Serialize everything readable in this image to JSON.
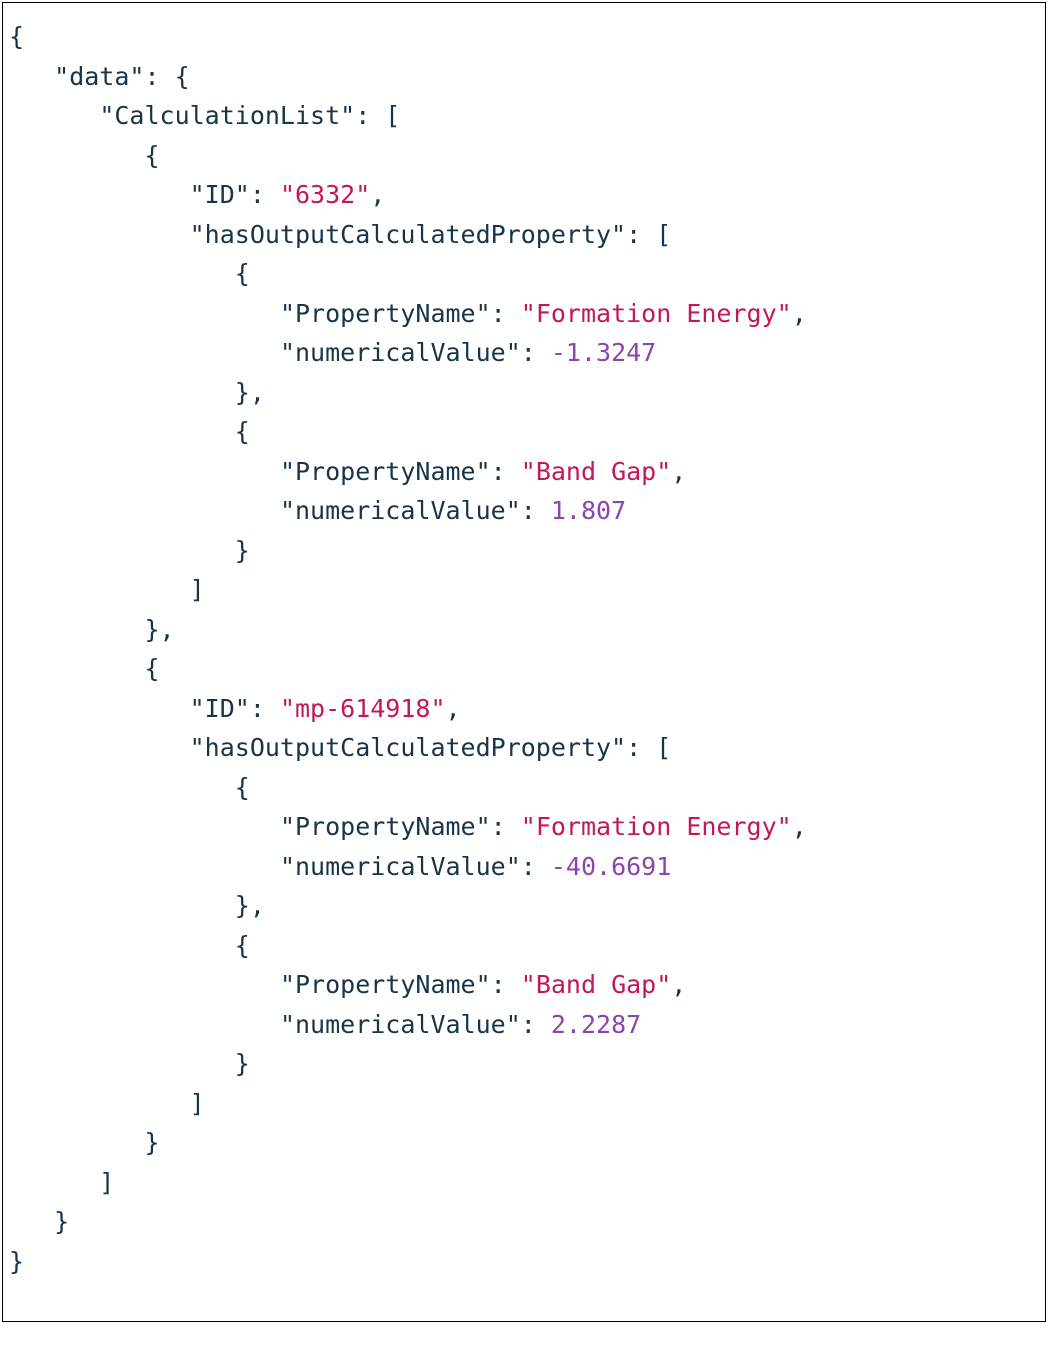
{
  "tokens": [
    {
      "t": "{",
      "c": "punct",
      "nl": true
    },
    {
      "t": "   ",
      "c": "punct"
    },
    {
      "t": "\"data\"",
      "c": "key"
    },
    {
      "t": ": {",
      "c": "punct",
      "nl": true
    },
    {
      "t": "      ",
      "c": "punct"
    },
    {
      "t": "\"CalculationList\"",
      "c": "key"
    },
    {
      "t": ": [",
      "c": "punct",
      "nl": true
    },
    {
      "t": "         {",
      "c": "punct",
      "nl": true
    },
    {
      "t": "            ",
      "c": "punct"
    },
    {
      "t": "\"ID\"",
      "c": "key"
    },
    {
      "t": ": ",
      "c": "punct"
    },
    {
      "t": "\"6332\"",
      "c": "str"
    },
    {
      "t": ",",
      "c": "punct",
      "nl": true
    },
    {
      "t": "            ",
      "c": "punct"
    },
    {
      "t": "\"hasOutputCalculatedProperty\"",
      "c": "key"
    },
    {
      "t": ": [",
      "c": "punct",
      "nl": true
    },
    {
      "t": "               {",
      "c": "punct",
      "nl": true
    },
    {
      "t": "                  ",
      "c": "punct"
    },
    {
      "t": "\"PropertyName\"",
      "c": "key"
    },
    {
      "t": ": ",
      "c": "punct"
    },
    {
      "t": "\"Formation Energy\"",
      "c": "str"
    },
    {
      "t": ",",
      "c": "punct",
      "nl": true
    },
    {
      "t": "                  ",
      "c": "punct"
    },
    {
      "t": "\"numericalValue\"",
      "c": "key"
    },
    {
      "t": ": ",
      "c": "punct"
    },
    {
      "t": "-1.3247",
      "c": "num",
      "nl": true
    },
    {
      "t": "               },",
      "c": "punct",
      "nl": true
    },
    {
      "t": "               {",
      "c": "punct",
      "nl": true
    },
    {
      "t": "                  ",
      "c": "punct"
    },
    {
      "t": "\"PropertyName\"",
      "c": "key"
    },
    {
      "t": ": ",
      "c": "punct"
    },
    {
      "t": "\"Band Gap\"",
      "c": "str"
    },
    {
      "t": ",",
      "c": "punct",
      "nl": true
    },
    {
      "t": "                  ",
      "c": "punct"
    },
    {
      "t": "\"numericalValue\"",
      "c": "key"
    },
    {
      "t": ": ",
      "c": "punct"
    },
    {
      "t": "1.807",
      "c": "num",
      "nl": true
    },
    {
      "t": "               }",
      "c": "punct",
      "nl": true
    },
    {
      "t": "            ]",
      "c": "punct",
      "nl": true
    },
    {
      "t": "         },",
      "c": "punct",
      "nl": true
    },
    {
      "t": "         {",
      "c": "punct",
      "nl": true
    },
    {
      "t": "            ",
      "c": "punct"
    },
    {
      "t": "\"ID\"",
      "c": "key"
    },
    {
      "t": ": ",
      "c": "punct"
    },
    {
      "t": "\"mp-614918\"",
      "c": "str"
    },
    {
      "t": ",",
      "c": "punct",
      "nl": true
    },
    {
      "t": "            ",
      "c": "punct"
    },
    {
      "t": "\"hasOutputCalculatedProperty\"",
      "c": "key"
    },
    {
      "t": ": [",
      "c": "punct",
      "nl": true
    },
    {
      "t": "               {",
      "c": "punct",
      "nl": true
    },
    {
      "t": "                  ",
      "c": "punct"
    },
    {
      "t": "\"PropertyName\"",
      "c": "key"
    },
    {
      "t": ": ",
      "c": "punct"
    },
    {
      "t": "\"Formation Energy\"",
      "c": "str"
    },
    {
      "t": ",",
      "c": "punct",
      "nl": true
    },
    {
      "t": "                  ",
      "c": "punct"
    },
    {
      "t": "\"numericalValue\"",
      "c": "key"
    },
    {
      "t": ": ",
      "c": "punct"
    },
    {
      "t": "-40.6691",
      "c": "num",
      "nl": true
    },
    {
      "t": "               },",
      "c": "punct",
      "nl": true
    },
    {
      "t": "               {",
      "c": "punct",
      "nl": true
    },
    {
      "t": "                  ",
      "c": "punct"
    },
    {
      "t": "\"PropertyName\"",
      "c": "key"
    },
    {
      "t": ": ",
      "c": "punct"
    },
    {
      "t": "\"Band Gap\"",
      "c": "str"
    },
    {
      "t": ",",
      "c": "punct",
      "nl": true
    },
    {
      "t": "                  ",
      "c": "punct"
    },
    {
      "t": "\"numericalValue\"",
      "c": "key"
    },
    {
      "t": ": ",
      "c": "punct"
    },
    {
      "t": "2.2287",
      "c": "num",
      "nl": true
    },
    {
      "t": "               }",
      "c": "punct",
      "nl": true
    },
    {
      "t": "            ]",
      "c": "punct",
      "nl": true
    },
    {
      "t": "         }",
      "c": "punct",
      "nl": true
    },
    {
      "t": "      ]",
      "c": "punct",
      "nl": true
    },
    {
      "t": "   }",
      "c": "punct",
      "nl": true
    },
    {
      "t": "}",
      "c": "punct",
      "nl": true
    }
  ],
  "json_payload": {
    "data": {
      "CalculationList": [
        {
          "ID": "6332",
          "hasOutputCalculatedProperty": [
            {
              "PropertyName": "Formation Energy",
              "numericalValue": -1.3247
            },
            {
              "PropertyName": "Band Gap",
              "numericalValue": 1.807
            }
          ]
        },
        {
          "ID": "mp-614918",
          "hasOutputCalculatedProperty": [
            {
              "PropertyName": "Formation Energy",
              "numericalValue": -40.6691
            },
            {
              "PropertyName": "Band Gap",
              "numericalValue": 2.2287
            }
          ]
        }
      ]
    }
  }
}
